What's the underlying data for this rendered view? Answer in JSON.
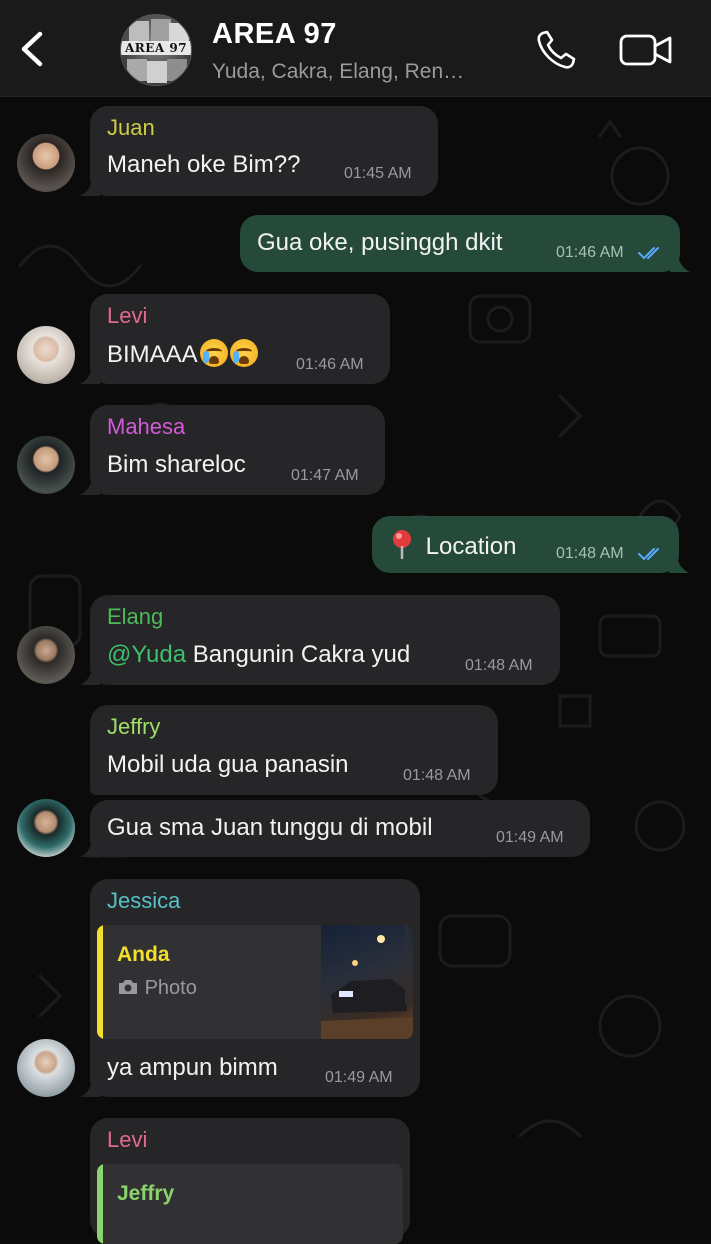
{
  "header": {
    "title": "AREA 97",
    "subtitle": "Yuda, Cakra, Elang, Ren…",
    "avatar_text": "AREA 97",
    "back_icon": "chevron-left-icon",
    "call_icon": "phone-icon",
    "video_icon": "video-camera-icon"
  },
  "colors": {
    "incoming_bubble": "#262628",
    "outgoing_bubble": "#254a3a",
    "read_ticks": "#5aa9ff",
    "mention": "#3fbf6b"
  },
  "messages": [
    {
      "sender": "Juan",
      "sender_color": "#cfcc45",
      "text": "Maneh oke Bim??",
      "time": "01:45 AM"
    },
    {
      "text": "Gua oke, pusinggh dkit",
      "time": "01:46 AM",
      "status": "read"
    },
    {
      "sender": "Levi",
      "sender_color": "#e06a8a",
      "text": "BIMAAA",
      "emoji": "😭😭",
      "time": "01:46 AM"
    },
    {
      "sender": "Mahesa",
      "sender_color": "#d35ad6",
      "text": "Bim shareloc",
      "time": "01:47 AM"
    },
    {
      "text": "Location",
      "location_icon": "📍",
      "time": "01:48 AM",
      "status": "read"
    },
    {
      "sender": "Elang",
      "sender_color": "#4cba58",
      "mention": "@Yuda",
      "text": " Bangunin Cakra yud",
      "time": "01:48 AM"
    },
    {
      "sender": "Jeffry",
      "sender_color": "#9fde68",
      "text": "Mobil uda gua panasin",
      "time": "01:48 AM"
    },
    {
      "text": "Gua sma Juan tunggu di mobil",
      "time": "01:49 AM"
    },
    {
      "sender": "Jessica",
      "sender_color": "#56c2c6",
      "reply_name": "Anda",
      "reply_text": "Photo",
      "reply_icon": "camera-icon",
      "text": "ya ampun bimm",
      "time": "01:49 AM"
    },
    {
      "sender": "Levi",
      "sender_color": "#e06a8a",
      "reply_name": "Jeffry"
    }
  ]
}
